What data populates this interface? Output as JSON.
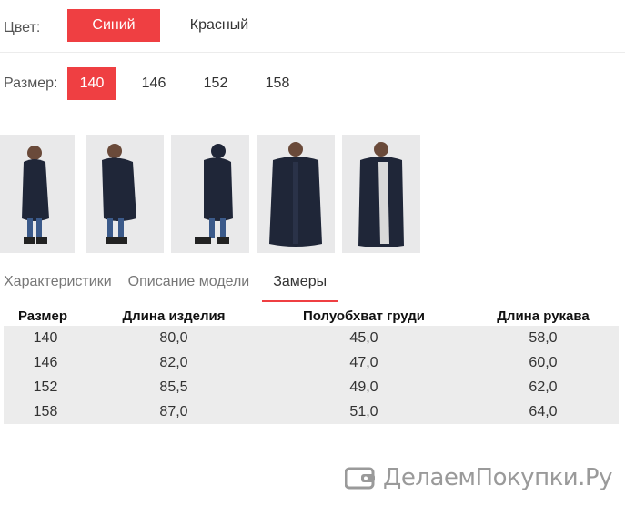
{
  "color": {
    "label": "Цвет:",
    "options": [
      {
        "label": "Синий",
        "selected": true
      },
      {
        "label": "Красный",
        "selected": false
      }
    ]
  },
  "size": {
    "label": "Размер:",
    "options": [
      "140",
      "146",
      "152",
      "158"
    ],
    "selected": "140"
  },
  "tabs": [
    {
      "label": "Характеристики",
      "active": false
    },
    {
      "label": "Описание модели",
      "active": false
    },
    {
      "label": "Замеры",
      "active": true
    }
  ],
  "table": {
    "headers": [
      "Размер",
      "Длина изделия",
      "Полуобхват груди",
      "Длина рукава"
    ],
    "rows": [
      [
        "140",
        "80,0",
        "45,0",
        "58,0"
      ],
      [
        "146",
        "82,0",
        "47,0",
        "60,0"
      ],
      [
        "152",
        "85,5",
        "49,0",
        "62,0"
      ],
      [
        "158",
        "87,0",
        "51,0",
        "64,0"
      ]
    ]
  },
  "watermark": {
    "text": "ДелаемПокупки.Ру"
  },
  "colors": {
    "accent": "#ef3f42",
    "table_bg": "#ececec",
    "coat": "#1f2638"
  }
}
